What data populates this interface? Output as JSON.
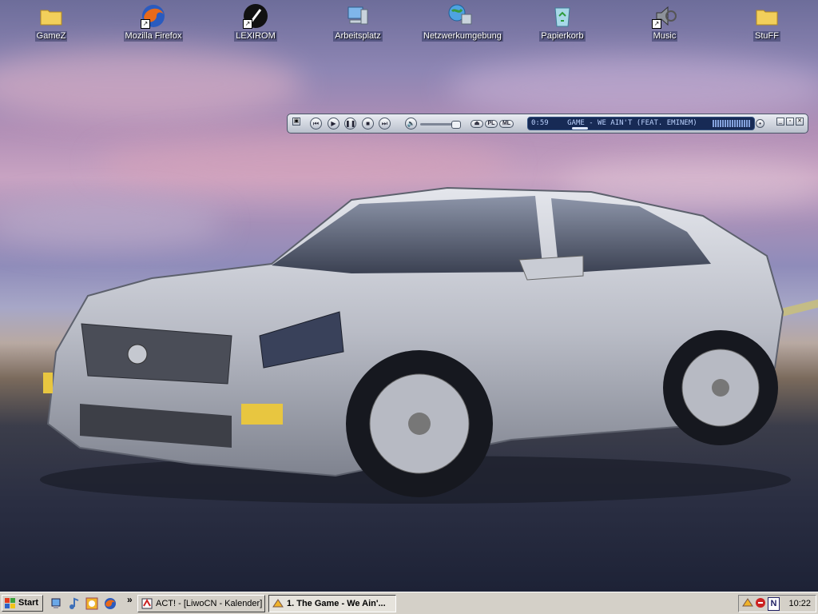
{
  "desktop": {
    "icons": [
      {
        "label": "GameZ",
        "icon": "folder-icon"
      },
      {
        "label": "Mozilla Firefox",
        "icon": "firefox-icon"
      },
      {
        "label": "LEXIROM",
        "icon": "lexirom-icon"
      },
      {
        "label": "Arbeitsplatz",
        "icon": "computer-icon"
      },
      {
        "label": "Netzwerkumgebung",
        "icon": "network-icon"
      },
      {
        "label": "Papierkorb",
        "icon": "recycle-bin-icon"
      },
      {
        "label": "Music",
        "icon": "music-icon"
      },
      {
        "label": "StuFF",
        "icon": "folder-icon"
      }
    ]
  },
  "player": {
    "time": "0:59",
    "track": "GAME - WE AIN'T (FEAT. EMINEM)",
    "buttons": {
      "pl": "PL",
      "ml": "ML"
    }
  },
  "taskbar": {
    "start_label": "Start",
    "tasks": [
      {
        "label": "ACT! - [LiwoCN - Kalender]",
        "active": false
      },
      {
        "label": "1. The Game - We Ain'...",
        "active": true
      }
    ],
    "chevron": "»",
    "clock": "10:22"
  },
  "colors": {
    "taskbar": "#d4d0c8",
    "player_display": "#172a55",
    "player_text": "#bcd3ff"
  }
}
